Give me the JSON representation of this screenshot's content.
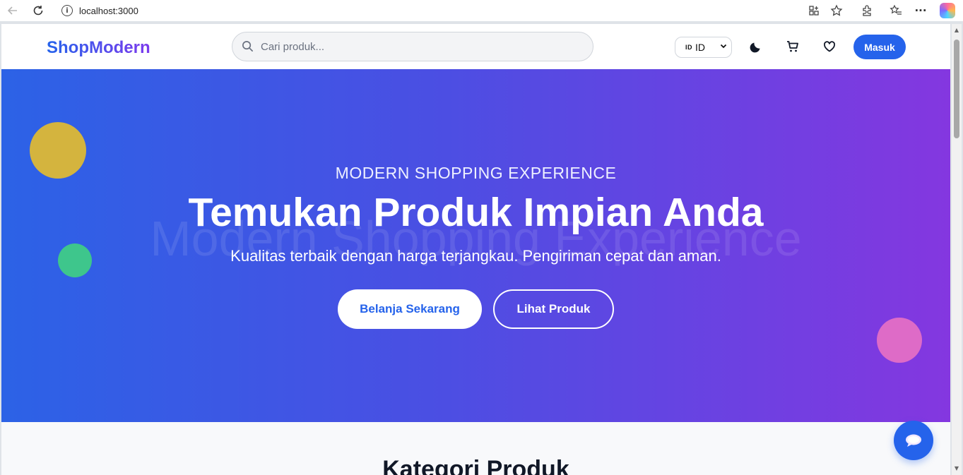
{
  "browser": {
    "url": "localhost:3000"
  },
  "header": {
    "logo": "ShopModern",
    "search_placeholder": "Cari produk...",
    "language": {
      "flag": "ID",
      "selected": "ID"
    },
    "login_label": "Masuk"
  },
  "hero": {
    "eyebrow": "MODERN SHOPPING EXPERIENCE",
    "watermark": "Modern Shopping Experience",
    "title": "Temukan Produk Impian Anda",
    "subtitle": "Kualitas terbaik dengan harga terjangkau. Pengiriman cepat dan aman.",
    "primary_cta": "Belanja Sekarang",
    "secondary_cta": "Lihat Produk"
  },
  "categories": {
    "title": "Kategori Produk"
  },
  "colors": {
    "brand": "#2563eb",
    "accent": "#7c3aed",
    "hero_start": "#2c62e6",
    "hero_end": "#8437e0"
  },
  "icons": [
    "back-icon",
    "reload-icon",
    "info-icon",
    "apps-icon",
    "star-icon",
    "extensions-icon",
    "favorites-icon",
    "more-icon",
    "search-icon",
    "moon-icon",
    "cart-icon",
    "heart-icon",
    "chat-icon"
  ]
}
